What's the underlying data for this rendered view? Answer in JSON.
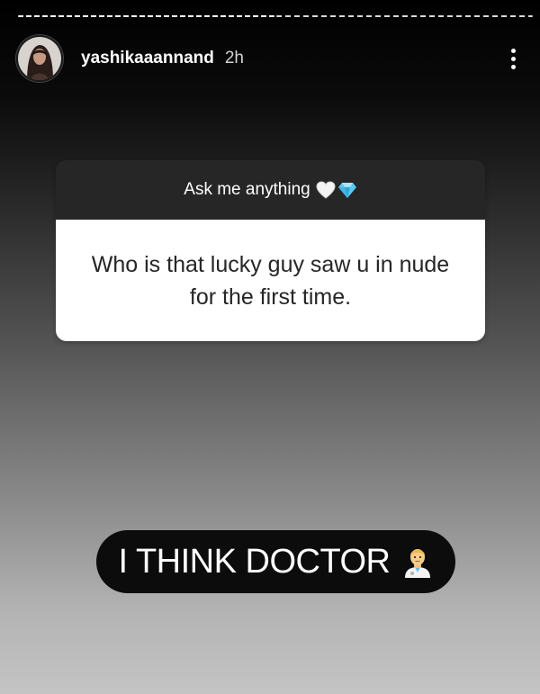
{
  "story": {
    "username": "yashikaaannand",
    "time_ago": "2h",
    "progress_segments": 2
  },
  "question_sticker": {
    "prompt": "Ask me anything",
    "prompt_emojis": [
      "white-heart",
      "gem-stone"
    ],
    "question": "Who is that lucky guy saw u in nude for the first time."
  },
  "answer": {
    "text": "I THINK DOCTOR",
    "emoji": "man-health-worker"
  },
  "colors": {
    "card_header": "#262626",
    "card_body": "#ffffff",
    "pill": "#0c0c0c"
  }
}
